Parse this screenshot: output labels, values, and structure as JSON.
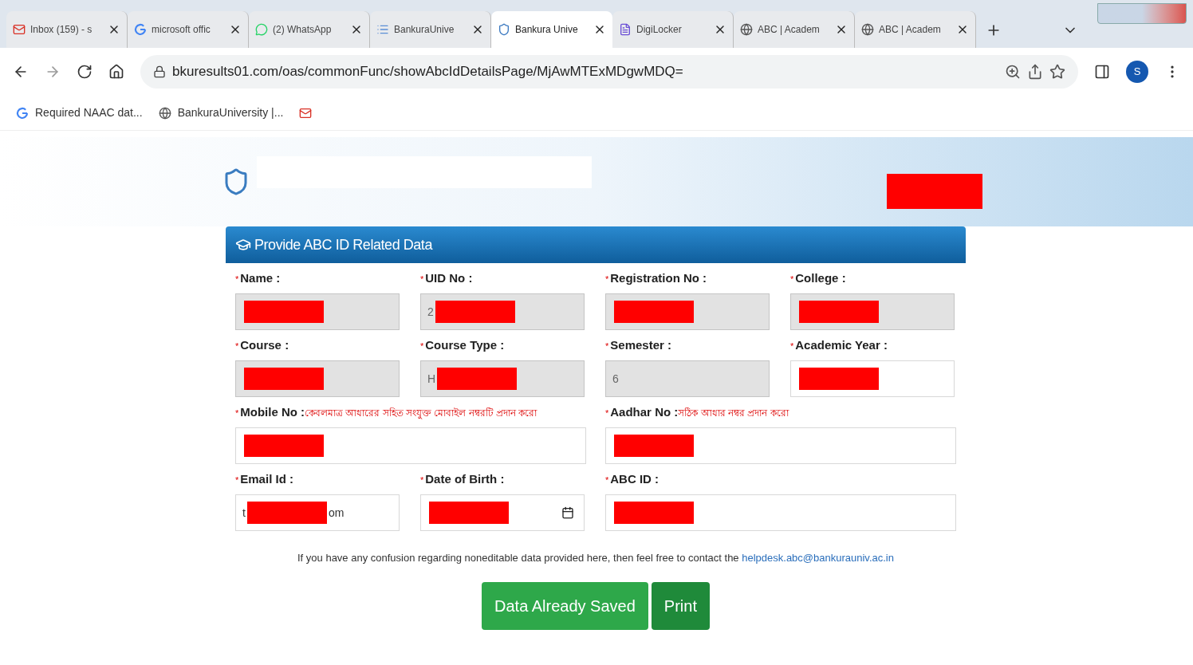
{
  "tabs": [
    {
      "title": "Inbox (159) - s",
      "selected": false
    },
    {
      "title": "microsoft offic",
      "selected": false
    },
    {
      "title": "(2) WhatsApp",
      "selected": false
    },
    {
      "title": "BankuraUnive",
      "selected": false
    },
    {
      "title": "Bankura Unive",
      "selected": true
    },
    {
      "title": "DigiLocker",
      "selected": false
    },
    {
      "title": "ABC | Academ",
      "selected": false
    },
    {
      "title": "ABC | Academ",
      "selected": false
    }
  ],
  "address": "bkuresults01.com/oas/commonFunc/showAbcIdDetailsPage/MjAwMTExMDgwMDQ=",
  "profile_initial": "S",
  "bookmarks": [
    {
      "title": "Required NAAC dat..."
    },
    {
      "title": "BankuraUniversity |..."
    }
  ],
  "panel_title": "Provide ABC ID Related Data",
  "rows": [
    {
      "fields": [
        {
          "marker": "*",
          "label": "Name :",
          "kind": "text",
          "disabled": true,
          "redacted": true
        },
        {
          "marker": "*",
          "label": "UID No :",
          "kind": "text",
          "disabled": true,
          "value": "2",
          "redacted": true
        },
        {
          "marker": "*",
          "label": "Registration No :",
          "kind": "text",
          "disabled": true,
          "redacted": true
        },
        {
          "marker": "*",
          "label": "College :",
          "kind": "text",
          "disabled": true,
          "redacted": true
        }
      ]
    },
    {
      "fields": [
        {
          "marker": "*",
          "label": "Course :",
          "kind": "text",
          "disabled": true,
          "redacted": true
        },
        {
          "marker": "*",
          "label": "Course Type :",
          "kind": "text",
          "disabled": true,
          "value": "H",
          "redacted": true
        },
        {
          "marker": "*",
          "label": "Semester :",
          "kind": "text",
          "disabled": true,
          "value": "6",
          "redacted": false
        },
        {
          "marker": "*",
          "label": "Academic Year :",
          "kind": "text",
          "disabled": false,
          "redacted": true
        }
      ]
    },
    {
      "fields": [
        {
          "marker": "*",
          "label": "Mobile No :",
          "hint": "কেবলমাত্র আধারের সহিত সংযুক্ত মোবাইল নম্বরটি প্রদান করো",
          "kind": "wide",
          "disabled": false,
          "redacted": true
        },
        {
          "marker": "*",
          "label": "Aadhar No :",
          "hint": "সঠিক আধার নম্বর প্রদান করো",
          "kind": "wide",
          "disabled": false,
          "redacted": true
        }
      ]
    },
    {
      "fields": [
        {
          "marker": "*",
          "label": "Email Id :",
          "kind": "text",
          "disabled": false,
          "value": "t",
          "value_tail": "om",
          "redacted": true
        },
        {
          "marker": "*",
          "label": "Date of Birth :",
          "kind": "date",
          "disabled": false,
          "redacted": true
        },
        {
          "marker": "*",
          "label": "ABC ID :",
          "kind": "wide",
          "disabled": false,
          "redacted": true
        }
      ]
    }
  ],
  "notice": "If you have any confusion regarding noneditable data provided here, then feel free to contact the",
  "notice_link": "helpdesk.abc@bankurauniv.ac.in",
  "buttons": [
    {
      "label": "Data Already Saved",
      "kind": "primary"
    },
    {
      "label": "Print",
      "kind": "secondary"
    }
  ]
}
